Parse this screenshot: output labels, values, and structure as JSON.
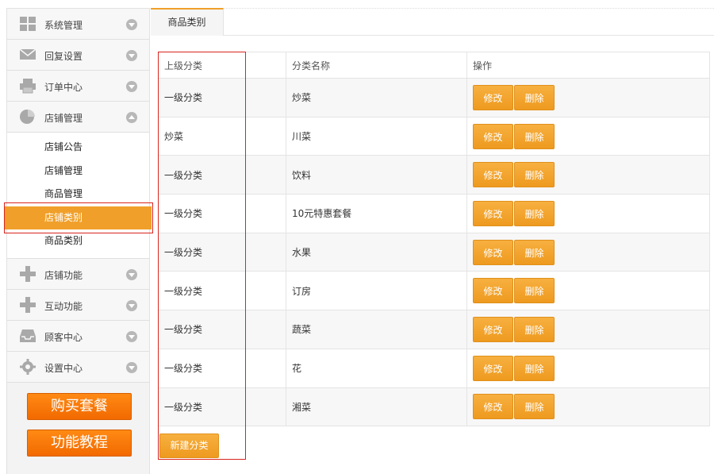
{
  "sidebar": {
    "menus_top": [
      {
        "label": "系统管理",
        "icon": "grid-icon"
      },
      {
        "label": "回复设置",
        "icon": "mail-icon"
      },
      {
        "label": "订单中心",
        "icon": "printer-icon"
      },
      {
        "label": "店铺管理",
        "icon": "pie-icon"
      }
    ],
    "submenu": [
      "店铺公告",
      "店铺管理",
      "商品管理",
      "店铺类别",
      "商品类别"
    ],
    "active_sub": "店铺类别",
    "menus_bottom": [
      {
        "label": "店铺功能",
        "icon": "plus-icon"
      },
      {
        "label": "互动功能",
        "icon": "plus-icon"
      },
      {
        "label": "顾客中心",
        "icon": "inbox-icon"
      },
      {
        "label": "设置中心",
        "icon": "gear-icon"
      }
    ],
    "buy_button": "购买套餐",
    "tutorial_button": "功能教程"
  },
  "tab": {
    "label": "商品类别"
  },
  "table": {
    "headers": [
      "上级分类",
      "分类名称",
      "操作"
    ],
    "rows": [
      {
        "parent": "一级分类",
        "name": "炒菜"
      },
      {
        "parent": "炒菜",
        "name": "川菜"
      },
      {
        "parent": "一级分类",
        "name": "饮料"
      },
      {
        "parent": "一级分类",
        "name": "10元特惠套餐"
      },
      {
        "parent": "一级分类",
        "name": "水果"
      },
      {
        "parent": "一级分类",
        "name": "订房"
      },
      {
        "parent": "一级分类",
        "name": "蔬菜"
      },
      {
        "parent": "一级分类",
        "name": "花"
      },
      {
        "parent": "一级分类",
        "name": "湘菜"
      }
    ],
    "edit_label": "修改",
    "delete_label": "删除"
  },
  "new_category_button": "新建分类",
  "colors": {
    "accent": "#f0a02a",
    "buy": "#f26a00",
    "highlight": "#d9251d"
  }
}
